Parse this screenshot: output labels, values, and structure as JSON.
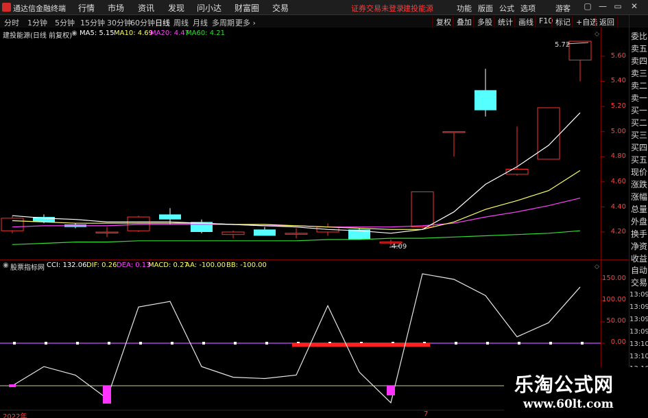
{
  "menubar": {
    "app_title": "通达信金融终端",
    "menus": [
      "行情",
      "市场",
      "资讯",
      "发现",
      "问小达",
      "财富圈",
      "交易"
    ],
    "warning": "证券交易未登录",
    "warning2": "建投能源",
    "right_menus": [
      "功能",
      "版面",
      "公式",
      "选项"
    ],
    "user": "游客",
    "win_controls": [
      "▢",
      "—",
      "▭",
      "✕"
    ]
  },
  "periods": [
    "分时",
    "1分钟",
    "5分钟",
    "15分钟",
    "30分钟",
    "60分钟",
    "日线",
    "周线",
    "月线",
    "多周期",
    "更多 ›"
  ],
  "active_period": "日线",
  "toolbar": [
    "复权",
    "叠加",
    "多股",
    "统计",
    "画线",
    "F10",
    "标记",
    "+自选",
    "返回"
  ],
  "main_legend": {
    "title": "建投能源(日线 前复权)",
    "items": [
      {
        "label": "MA5: 5.15",
        "color": "#ffffff"
      },
      {
        "label": "MA10: 4.69",
        "color": "#ffff66"
      },
      {
        "label": "MA20: 4.47",
        "color": "#ff44ff"
      },
      {
        "label": "MA60: 4.21",
        "color": "#33dd33"
      }
    ]
  },
  "price_axis": [
    "5.60",
    "5.40",
    "5.20",
    "5.00",
    "4.80",
    "4.60",
    "4.40",
    "4.20"
  ],
  "high_label": "5.72",
  "low_label": "4.09",
  "sidebar_items": [
    "委比",
    "卖五",
    "卖四",
    "卖三",
    "卖二",
    "卖一",
    "买一",
    "买二",
    "买三",
    "买四",
    "买五",
    "现价",
    "涨跌",
    "涨幅",
    "总量",
    "外盘",
    "换手",
    "净资",
    "收益"
  ],
  "sidebar_bottom": [
    "自动",
    "交易"
  ],
  "time_labels": [
    "13:09",
    "13:09",
    "13:09",
    "13:09",
    "13:10",
    "13:10",
    "13:10"
  ],
  "ind_legend": {
    "title": "股票指标网",
    "items": [
      {
        "label": "CCI: 132.06",
        "color": "#ffffff"
      },
      {
        "label": "DIF: 0.26",
        "color": "#ffff66"
      },
      {
        "label": "DEA: 0.13",
        "color": "#ff44ff"
      },
      {
        "label": "MACD: 0.27",
        "color": "#ffff66"
      },
      {
        "label": "AA: -100.00",
        "color": "#ffff66"
      },
      {
        "label": "BB: -100.00",
        "color": "#ffff66"
      }
    ]
  },
  "ind_axis": [
    "150.00",
    "100.00",
    "50.00",
    "0.00"
  ],
  "date_labels": [
    "2022年",
    "7"
  ],
  "watermark": {
    "title": "乐淘公式网",
    "url": "www.60lt.com"
  },
  "colors": {
    "up": "#ff3030",
    "down": "#55ffff",
    "bg": "#000000",
    "axis_red": "#7a0000"
  },
  "chart_data": {
    "type": "candlestick",
    "candles": [
      {
        "o": 4.21,
        "h": 4.33,
        "l": 4.19,
        "c": 4.31
      },
      {
        "o": 4.32,
        "h": 4.34,
        "l": 4.27,
        "c": 4.28
      },
      {
        "o": 4.26,
        "h": 4.27,
        "l": 4.23,
        "c": 4.24
      },
      {
        "o": 4.2,
        "h": 4.24,
        "l": 4.16,
        "c": 4.2
      },
      {
        "o": 4.21,
        "h": 4.33,
        "l": 4.2,
        "c": 4.32
      },
      {
        "o": 4.34,
        "h": 4.39,
        "l": 4.26,
        "c": 4.3
      },
      {
        "o": 4.28,
        "h": 4.3,
        "l": 4.19,
        "c": 4.2
      },
      {
        "o": 4.18,
        "h": 4.21,
        "l": 4.15,
        "c": 4.2
      },
      {
        "o": 4.22,
        "h": 4.24,
        "l": 4.17,
        "c": 4.17
      },
      {
        "o": 4.19,
        "h": 4.23,
        "l": 4.15,
        "c": 4.19
      },
      {
        "o": 4.2,
        "h": 4.27,
        "l": 4.17,
        "c": 4.24
      },
      {
        "o": 4.22,
        "h": 4.23,
        "l": 4.14,
        "c": 4.14
      },
      {
        "o": 4.12,
        "h": 4.14,
        "l": 4.09,
        "c": 4.12
      },
      {
        "o": 4.24,
        "h": 4.52,
        "l": 4.23,
        "c": 4.52
      },
      {
        "o": 5.0,
        "h": 5.0,
        "l": 4.8,
        "c": 5.0
      },
      {
        "o": 5.33,
        "h": 5.5,
        "l": 5.12,
        "c": 5.17
      },
      {
        "o": 4.66,
        "h": 5.04,
        "l": 4.65,
        "c": 4.7
      },
      {
        "o": 4.78,
        "h": 5.19,
        "l": 4.78,
        "c": 5.19
      },
      {
        "o": 5.57,
        "h": 5.72,
        "l": 5.4,
        "c": 5.72
      }
    ],
    "ma5": [
      4.33,
      4.31,
      4.3,
      4.28,
      4.28,
      4.28,
      4.27,
      4.26,
      4.25,
      4.24,
      4.22,
      4.21,
      4.19,
      4.22,
      4.36,
      4.58,
      4.72,
      4.89,
      5.15
    ],
    "ma10": [
      4.29,
      4.28,
      4.27,
      4.27,
      4.27,
      4.27,
      4.27,
      4.26,
      4.26,
      4.25,
      4.24,
      4.23,
      4.22,
      4.22,
      4.28,
      4.38,
      4.45,
      4.53,
      4.69
    ],
    "ma20": [
      4.24,
      4.25,
      4.25,
      4.25,
      4.26,
      4.26,
      4.26,
      4.26,
      4.25,
      4.25,
      4.24,
      4.24,
      4.24,
      4.25,
      4.27,
      4.32,
      4.36,
      4.41,
      4.47
    ],
    "ma60": [
      4.1,
      4.11,
      4.12,
      4.12,
      4.13,
      4.13,
      4.13,
      4.13,
      4.13,
      4.13,
      4.14,
      4.14,
      4.15,
      4.15,
      4.16,
      4.17,
      4.18,
      4.19,
      4.21
    ],
    "cci": [
      -100,
      -55,
      -75,
      -130,
      85,
      98,
      -55,
      -80,
      -83,
      -75,
      88,
      -68,
      -140,
      163,
      150,
      112,
      15,
      48,
      132
    ],
    "macd_bars": [
      {
        "from": 9,
        "to": 13,
        "value": -0.03
      }
    ],
    "aa_bb_markers": [
      0,
      3,
      12
    ],
    "ylim_price": [
      4.06,
      5.76
    ],
    "ylim_ind": [
      -140,
      175
    ]
  }
}
